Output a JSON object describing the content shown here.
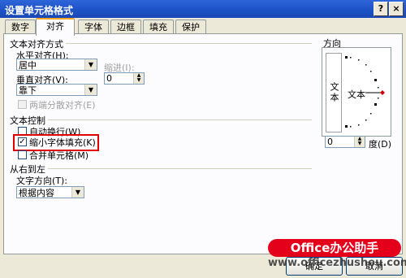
{
  "window": {
    "title": "设置单元格格式",
    "help_btn": "?",
    "close_btn": "×"
  },
  "tabs": [
    {
      "label": "数字",
      "active": false
    },
    {
      "label": "对齐",
      "active": true
    },
    {
      "label": "字体",
      "active": false
    },
    {
      "label": "边框",
      "active": false
    },
    {
      "label": "填充",
      "active": false
    },
    {
      "label": "保护",
      "active": false
    }
  ],
  "alignment": {
    "group_label": "文本对齐方式",
    "horizontal_label": "水平对齐(H):",
    "horizontal_value": "居中",
    "indent_label": "缩进(I):",
    "indent_value": "0",
    "vertical_label": "垂直对齐(V):",
    "vertical_value": "靠下",
    "distributed_label": "两端分散对齐(E)"
  },
  "text_control": {
    "group_label": "文本控制",
    "wrap_label": "自动换行(W)",
    "shrink_label": "缩小字体填充(K)",
    "merge_label": "合并单元格(M)"
  },
  "rtl": {
    "group_label": "从右到左",
    "direction_label": "文字方向(T):",
    "direction_value": "根据内容"
  },
  "orientation": {
    "group_label": "方向",
    "vertical_text": "文本",
    "horizontal_text": "文本",
    "degrees_value": "0",
    "degrees_label": "度(D)"
  },
  "buttons": {
    "ok": "确定",
    "cancel": "取消"
  },
  "watermark": {
    "badge": "Office办公助手",
    "url": "www.officezhushou.com"
  },
  "colors": {
    "accent": "#E00000",
    "title_bar": "#1F55C8",
    "tab_highlight": "#F5A623"
  }
}
